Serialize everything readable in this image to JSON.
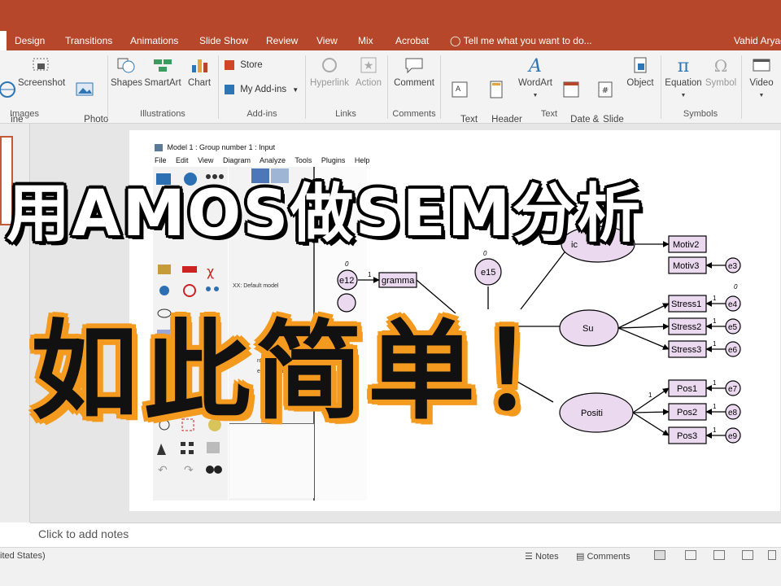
{
  "ribbon_tabs": [
    "Design",
    "Transitions",
    "Animations",
    "Slide Show",
    "Review",
    "View",
    "Mix",
    "Acrobat"
  ],
  "tell_me": "Tell me what you want to do...",
  "user_name": "Vahid Aryad",
  "ribbon": {
    "images_group": {
      "online_pictures": "ine\nures",
      "screenshot": "Screenshot",
      "photo_album": "Photo\nAlbum",
      "label": "Images"
    },
    "illustrations_group": {
      "shapes": "Shapes",
      "smartart": "SmartArt",
      "chart": "Chart",
      "label": "Illustrations"
    },
    "addins_group": {
      "store": "Store",
      "my_addins": "My Add-ins",
      "label": "Add-ins"
    },
    "links_group": {
      "hyperlink": "Hyperlink",
      "action": "Action",
      "label": "Links"
    },
    "comments_group": {
      "comment": "Comment",
      "label": "Comments"
    },
    "text_group": {
      "text_box": "Text\nBox",
      "header_footer": "Header\n& Footer",
      "wordart": "WordArt",
      "date_time": "Date &\nTime",
      "slide_number": "Slide\nNumber",
      "object": "Object",
      "label": "Text"
    },
    "symbols_group": {
      "equation": "Equation",
      "symbol": "Symbol",
      "label": "Symbols"
    },
    "media_group": {
      "video": "Video"
    }
  },
  "amos": {
    "title": "Model 1 : Group number 1 : Input",
    "menu": [
      "File",
      "Edit",
      "View",
      "Diagram",
      "Analyze",
      "Tools",
      "Plugins",
      "Help"
    ],
    "pane_label": "XX: Default model",
    "estimates_1": "rdized estimate",
    "estimates_2": "ed estimates",
    "nodes": {
      "e12": "e12",
      "grammar": "gramma",
      "e15": "e15",
      "motiv2": "Motiv2",
      "motiv3": "Motiv3",
      "e3": "e3",
      "stress1": "Stress1",
      "stress2": "Stress2",
      "stress3": "Stress3",
      "e4": "e4",
      "e5": "e5",
      "e6": "e6",
      "pos1": "Pos1",
      "pos2": "Pos2",
      "pos3": "Pos3",
      "e7": "e7",
      "e8": "e8",
      "e9": "e9",
      "su": "Su",
      "posi": "Positi",
      "top_lv": "ic"
    },
    "numbers": {
      "zero": "0",
      "one": "1"
    }
  },
  "headline_1": "用AMOS做SEM分析",
  "headline_2": "如此简单！",
  "notes_placeholder": "Click to add notes",
  "status": {
    "language": "ited States)",
    "notes": "Notes",
    "comments": "Comments"
  },
  "colors": {
    "accent": "#b7472a",
    "headline_outline": "#f39a1f",
    "node_fill": "#ebd9f0"
  }
}
